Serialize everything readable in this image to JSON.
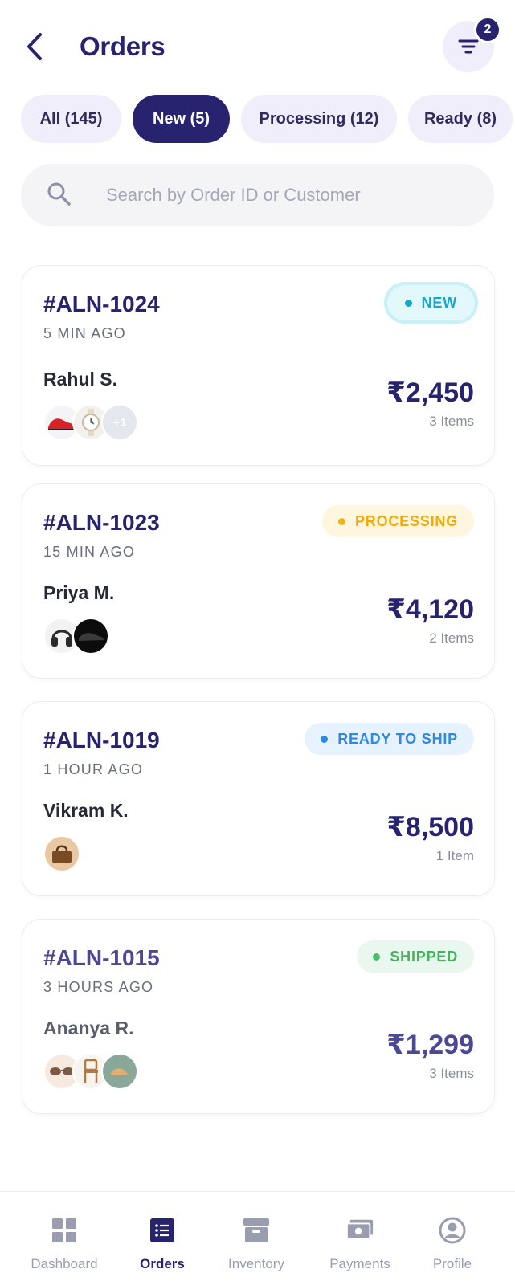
{
  "header": {
    "title": "Orders",
    "filter_badge_count": "2"
  },
  "tabs": [
    {
      "label": "All (145)",
      "active": false
    },
    {
      "label": "New (5)",
      "active": true
    },
    {
      "label": "Processing (12)",
      "active": false
    },
    {
      "label": "Ready (8)",
      "active": false
    }
  ],
  "search": {
    "placeholder": "Search by Order ID or Customer",
    "value": ""
  },
  "orders": [
    {
      "id": "#ALN-1024",
      "time": "5 MIN AGO",
      "customer": "Rahul S.",
      "status": "NEW",
      "amount": "₹2,450",
      "items": "3 Items",
      "thumbnails": [
        "red-sneaker",
        "wrist-watch"
      ],
      "more_count": "+1"
    },
    {
      "id": "#ALN-1023",
      "time": "15 MIN AGO",
      "customer": "Priya M.",
      "status": "PROCESSING",
      "amount": "₹4,120",
      "items": "2 Items",
      "thumbnails": [
        "headphones",
        "black-shoe"
      ]
    },
    {
      "id": "#ALN-1019",
      "time": "1 HOUR AGO",
      "customer": "Vikram K.",
      "status": "READY TO SHIP",
      "amount": "₹8,500",
      "items": "1 Item",
      "thumbnails": [
        "leather-bag"
      ]
    },
    {
      "id": "#ALN-1015",
      "time": "3 HOURS AGO",
      "customer": "Ananya R.",
      "status": "SHIPPED",
      "amount": "₹1,299",
      "items": "3 Items",
      "thumbnails": [
        "sunglasses",
        "wooden-chair",
        "cap"
      ]
    }
  ],
  "bottom_nav": [
    {
      "label": "Dashboard",
      "icon": "grid-icon",
      "active": false
    },
    {
      "label": "Orders",
      "icon": "list-icon",
      "active": true
    },
    {
      "label": "Inventory",
      "icon": "archive-icon",
      "active": false
    },
    {
      "label": "Payments",
      "icon": "cash-icon",
      "active": false
    },
    {
      "label": "Profile",
      "icon": "user-circle-icon",
      "active": false
    }
  ],
  "colors": {
    "primary": "#27236e",
    "new": "#1aa6c8",
    "processing": "#f2a90a",
    "ready": "#2b8ae2",
    "shipped": "#3fb55d"
  }
}
